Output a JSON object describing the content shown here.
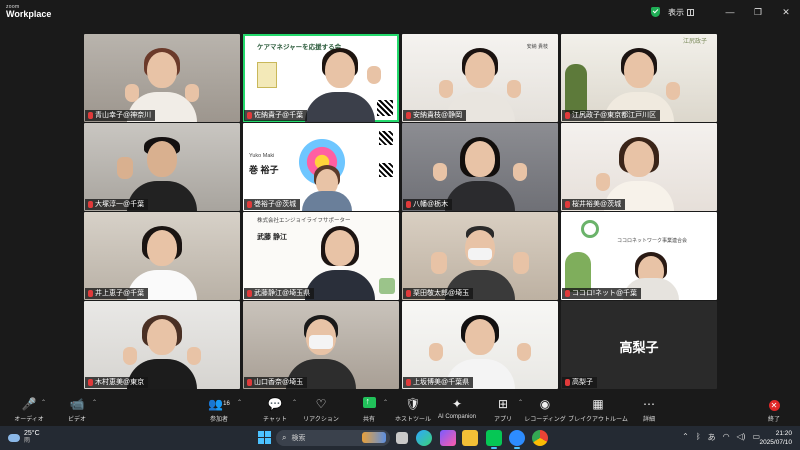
{
  "app": {
    "logo_top": "zoom",
    "logo_bottom": "Workplace",
    "view_label": "表示",
    "window_controls": [
      "—",
      "❐",
      "✕"
    ]
  },
  "participants": [
    {
      "name": "青山幸子@神奈川",
      "muted": true
    },
    {
      "name": "佐納貴子@千葉",
      "muted": true,
      "active": true
    },
    {
      "name": "安納貴枝@静岡",
      "muted": true
    },
    {
      "name": "江尻政子@東京都江戸川区",
      "muted": true
    },
    {
      "name": "大塚淳一@千葉",
      "muted": true
    },
    {
      "name": "巻裕子@茨城",
      "muted": true
    },
    {
      "name": "八幡@栃木",
      "muted": true
    },
    {
      "name": "桜井裕美@茨城",
      "muted": true
    },
    {
      "name": "井上恵子@千葉",
      "muted": true
    },
    {
      "name": "武藤静江@埼玉県",
      "muted": true
    },
    {
      "name": "栗田敬太郎@埼玉",
      "muted": true
    },
    {
      "name": "ココロ!ネット@千葉",
      "muted": true
    },
    {
      "name": "木村恵美@東京",
      "muted": true
    },
    {
      "name": "山口香奈@埼玉",
      "muted": true
    },
    {
      "name": "上坂博美@千葉県",
      "muted": true
    },
    {
      "name": "高梨子",
      "muted": true,
      "video_off": true
    }
  ],
  "tiles_text": {
    "card2_title": "ケアマネジャーを応援する会",
    "card6_name_en": "Yuko Maki",
    "card6_name_jp": "巻 裕子",
    "card10_company": "株式会社エンジョイライフサポーター",
    "card10_name": "武藤 静江",
    "card12_title": "ココロネットワーク事業連合会",
    "card4_sign": "江尻政子",
    "card3_sign": "安納 貴枝",
    "video_off_label": "高梨子"
  },
  "toolbar": {
    "items": [
      {
        "label": "オーディオ",
        "icon": "🎤"
      },
      {
        "label": "ビデオ",
        "icon": "📹"
      },
      {
        "label": "参加者",
        "icon": "👥",
        "count": "16"
      },
      {
        "label": "チャット",
        "icon": "💬"
      },
      {
        "label": "リアクション",
        "icon": "♡"
      },
      {
        "label": "共有",
        "icon": "share"
      },
      {
        "label": "ホストツール",
        "icon": "🛡"
      },
      {
        "label": "AI Companion",
        "icon": "✦"
      },
      {
        "label": "アプリ",
        "icon": "⊞"
      },
      {
        "label": "レコーディング",
        "icon": "◉"
      },
      {
        "label": "ブレイクアウトルーム",
        "icon": "▦"
      },
      {
        "label": "詳細",
        "icon": "⋯"
      },
      {
        "label": "終了",
        "icon": "✕"
      }
    ]
  },
  "taskbar": {
    "weather_temp": "25°C",
    "weather_desc": "雨",
    "search_placeholder": "検索",
    "search_icon": "magnifier-icon",
    "ime": "あ",
    "time": "21:20",
    "date": "2025/07/10"
  },
  "colors": {
    "active_speaker": "#23d96c",
    "muted_icon": "#e03a3a",
    "end_button": "#e02828",
    "share_button": "#21c15a"
  }
}
